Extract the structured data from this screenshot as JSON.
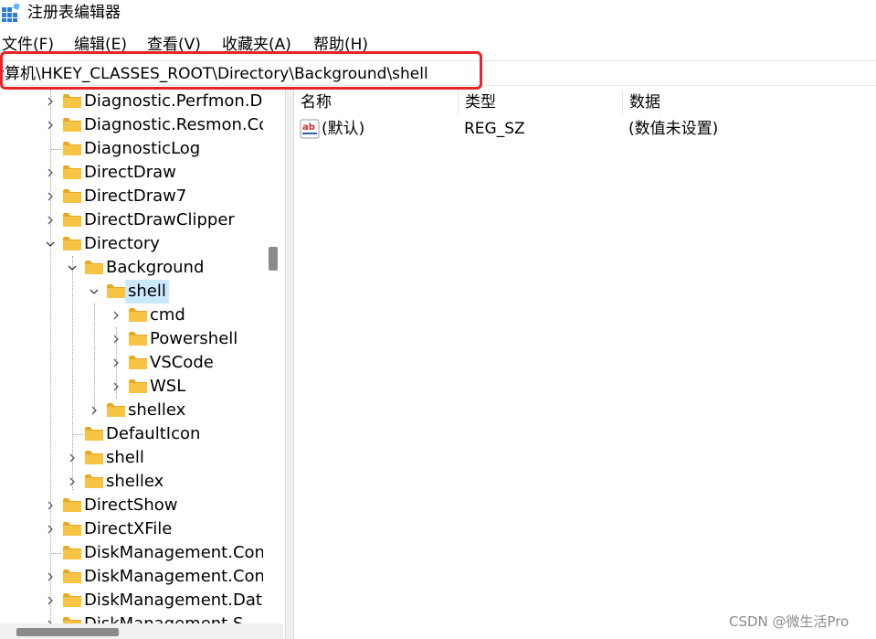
{
  "window": {
    "title": "注册表编辑器",
    "icon": "registry-editor-icon"
  },
  "menu": [
    "文件(F)",
    "编辑(E)",
    "查看(V)",
    "收藏夹(A)",
    "帮助(H)"
  ],
  "address": {
    "path": "计算机\\HKEY_CLASSES_ROOT\\Directory\\Background\\shell"
  },
  "tree": {
    "items": [
      {
        "label": "Diagnostic.Perfmon.Do",
        "level": 0,
        "expander": "collapsed"
      },
      {
        "label": "Diagnostic.Resmon.Co",
        "level": 0,
        "expander": "collapsed"
      },
      {
        "label": "DiagnosticLog",
        "level": 0,
        "expander": "none"
      },
      {
        "label": "DirectDraw",
        "level": 0,
        "expander": "collapsed"
      },
      {
        "label": "DirectDraw7",
        "level": 0,
        "expander": "collapsed"
      },
      {
        "label": "DirectDrawClipper",
        "level": 0,
        "expander": "collapsed"
      },
      {
        "label": "Directory",
        "level": 0,
        "expander": "expanded"
      },
      {
        "label": "Background",
        "level": 1,
        "expander": "expanded"
      },
      {
        "label": "shell",
        "level": 2,
        "expander": "expanded",
        "selected": true
      },
      {
        "label": "cmd",
        "level": 3,
        "expander": "collapsed"
      },
      {
        "label": "Powershell",
        "level": 3,
        "expander": "collapsed"
      },
      {
        "label": "VSCode",
        "level": 3,
        "expander": "collapsed"
      },
      {
        "label": "WSL",
        "level": 3,
        "expander": "collapsed"
      },
      {
        "label": "shellex",
        "level": 2,
        "expander": "collapsed"
      },
      {
        "label": "DefaultIcon",
        "level": 1,
        "expander": "none"
      },
      {
        "label": "shell",
        "level": 1,
        "expander": "collapsed"
      },
      {
        "label": "shellex",
        "level": 1,
        "expander": "collapsed"
      },
      {
        "label": "DirectShow",
        "level": 0,
        "expander": "collapsed"
      },
      {
        "label": "DirectXFile",
        "level": 0,
        "expander": "collapsed"
      },
      {
        "label": "DiskManagement.Con",
        "level": 0,
        "expander": "none"
      },
      {
        "label": "DiskManagement.Con",
        "level": 0,
        "expander": "collapsed"
      },
      {
        "label": "DiskManagement.Data",
        "level": 0,
        "expander": "collapsed"
      },
      {
        "label": "DiskManagement.S",
        "level": 0,
        "expander": "collapsed"
      }
    ]
  },
  "values": {
    "columns": [
      "名称",
      "类型",
      "数据"
    ],
    "rows": [
      {
        "name": "(默认)",
        "type": "REG_SZ",
        "data": "(数值未设置)",
        "icon": "string-value-icon"
      }
    ]
  },
  "watermark": "CSDN @微生活Pro",
  "colors": {
    "selection": "#cce8ff",
    "highlight_box": "#e8232a",
    "folder": "#f6c342",
    "folder_dark": "#e7a823"
  }
}
